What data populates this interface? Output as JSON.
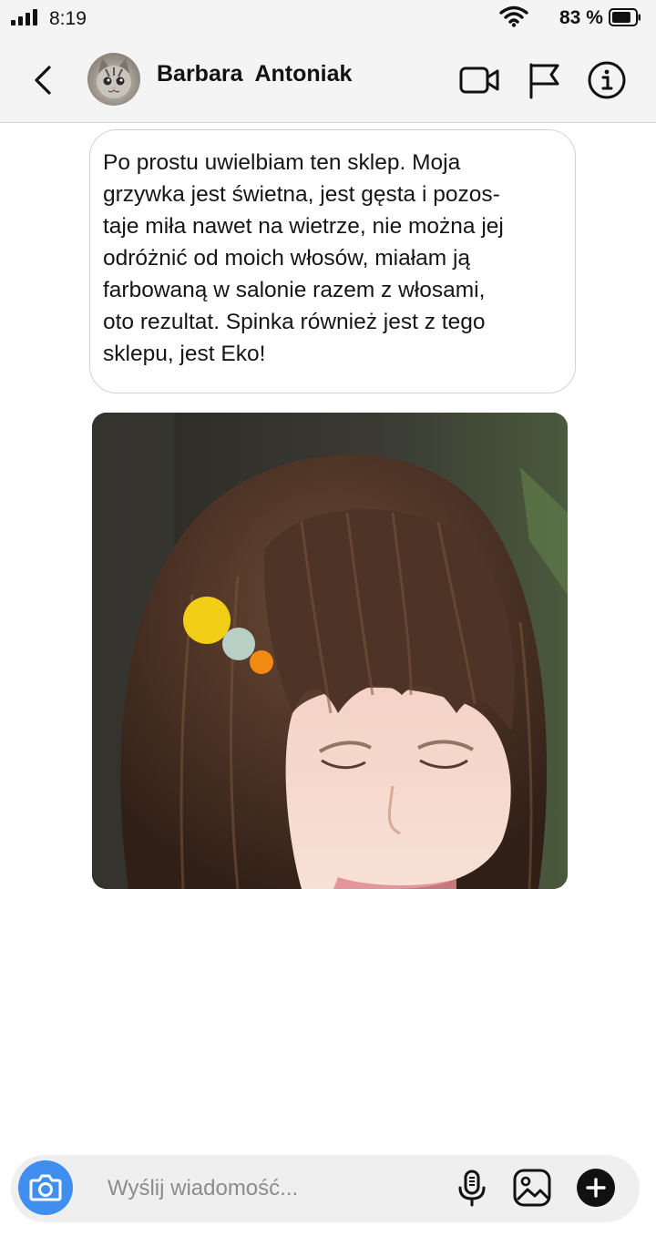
{
  "status_bar": {
    "time": "8:19",
    "battery_percent": "83 %",
    "signal_bars": 4,
    "battery_level": 0.83
  },
  "header": {
    "contact_name": "Barbara  Antoniak",
    "icons": [
      "back-chevron-icon",
      "video-call-icon",
      "flag-icon",
      "info-icon"
    ]
  },
  "message": {
    "text": "Po prostu uwielbiam ten sklep. Moja\ngrzywka jest świetna, jest gęsta i pozos-\ntaje miła  nawet na wietrze, nie można jej\nodróżnić od moich włosów, miałam ją\nfarbowaną w salonie razem z włosami,\noto rezultat. Spinka również jest z tego\nsklepu, jest Eko!"
  },
  "composer": {
    "placeholder": "Wyślij wiadomość...",
    "icons": [
      "camera-icon",
      "microphone-icon",
      "gallery-icon",
      "plus-icon"
    ]
  },
  "colors": {
    "accent_blue": "#3f8ef0",
    "header_bg": "#f4f4f4",
    "composer_bg": "#efefef",
    "clip_yellow": "#f2cf16",
    "clip_mint": "#b8cfc6",
    "clip_orange": "#f08a10"
  }
}
